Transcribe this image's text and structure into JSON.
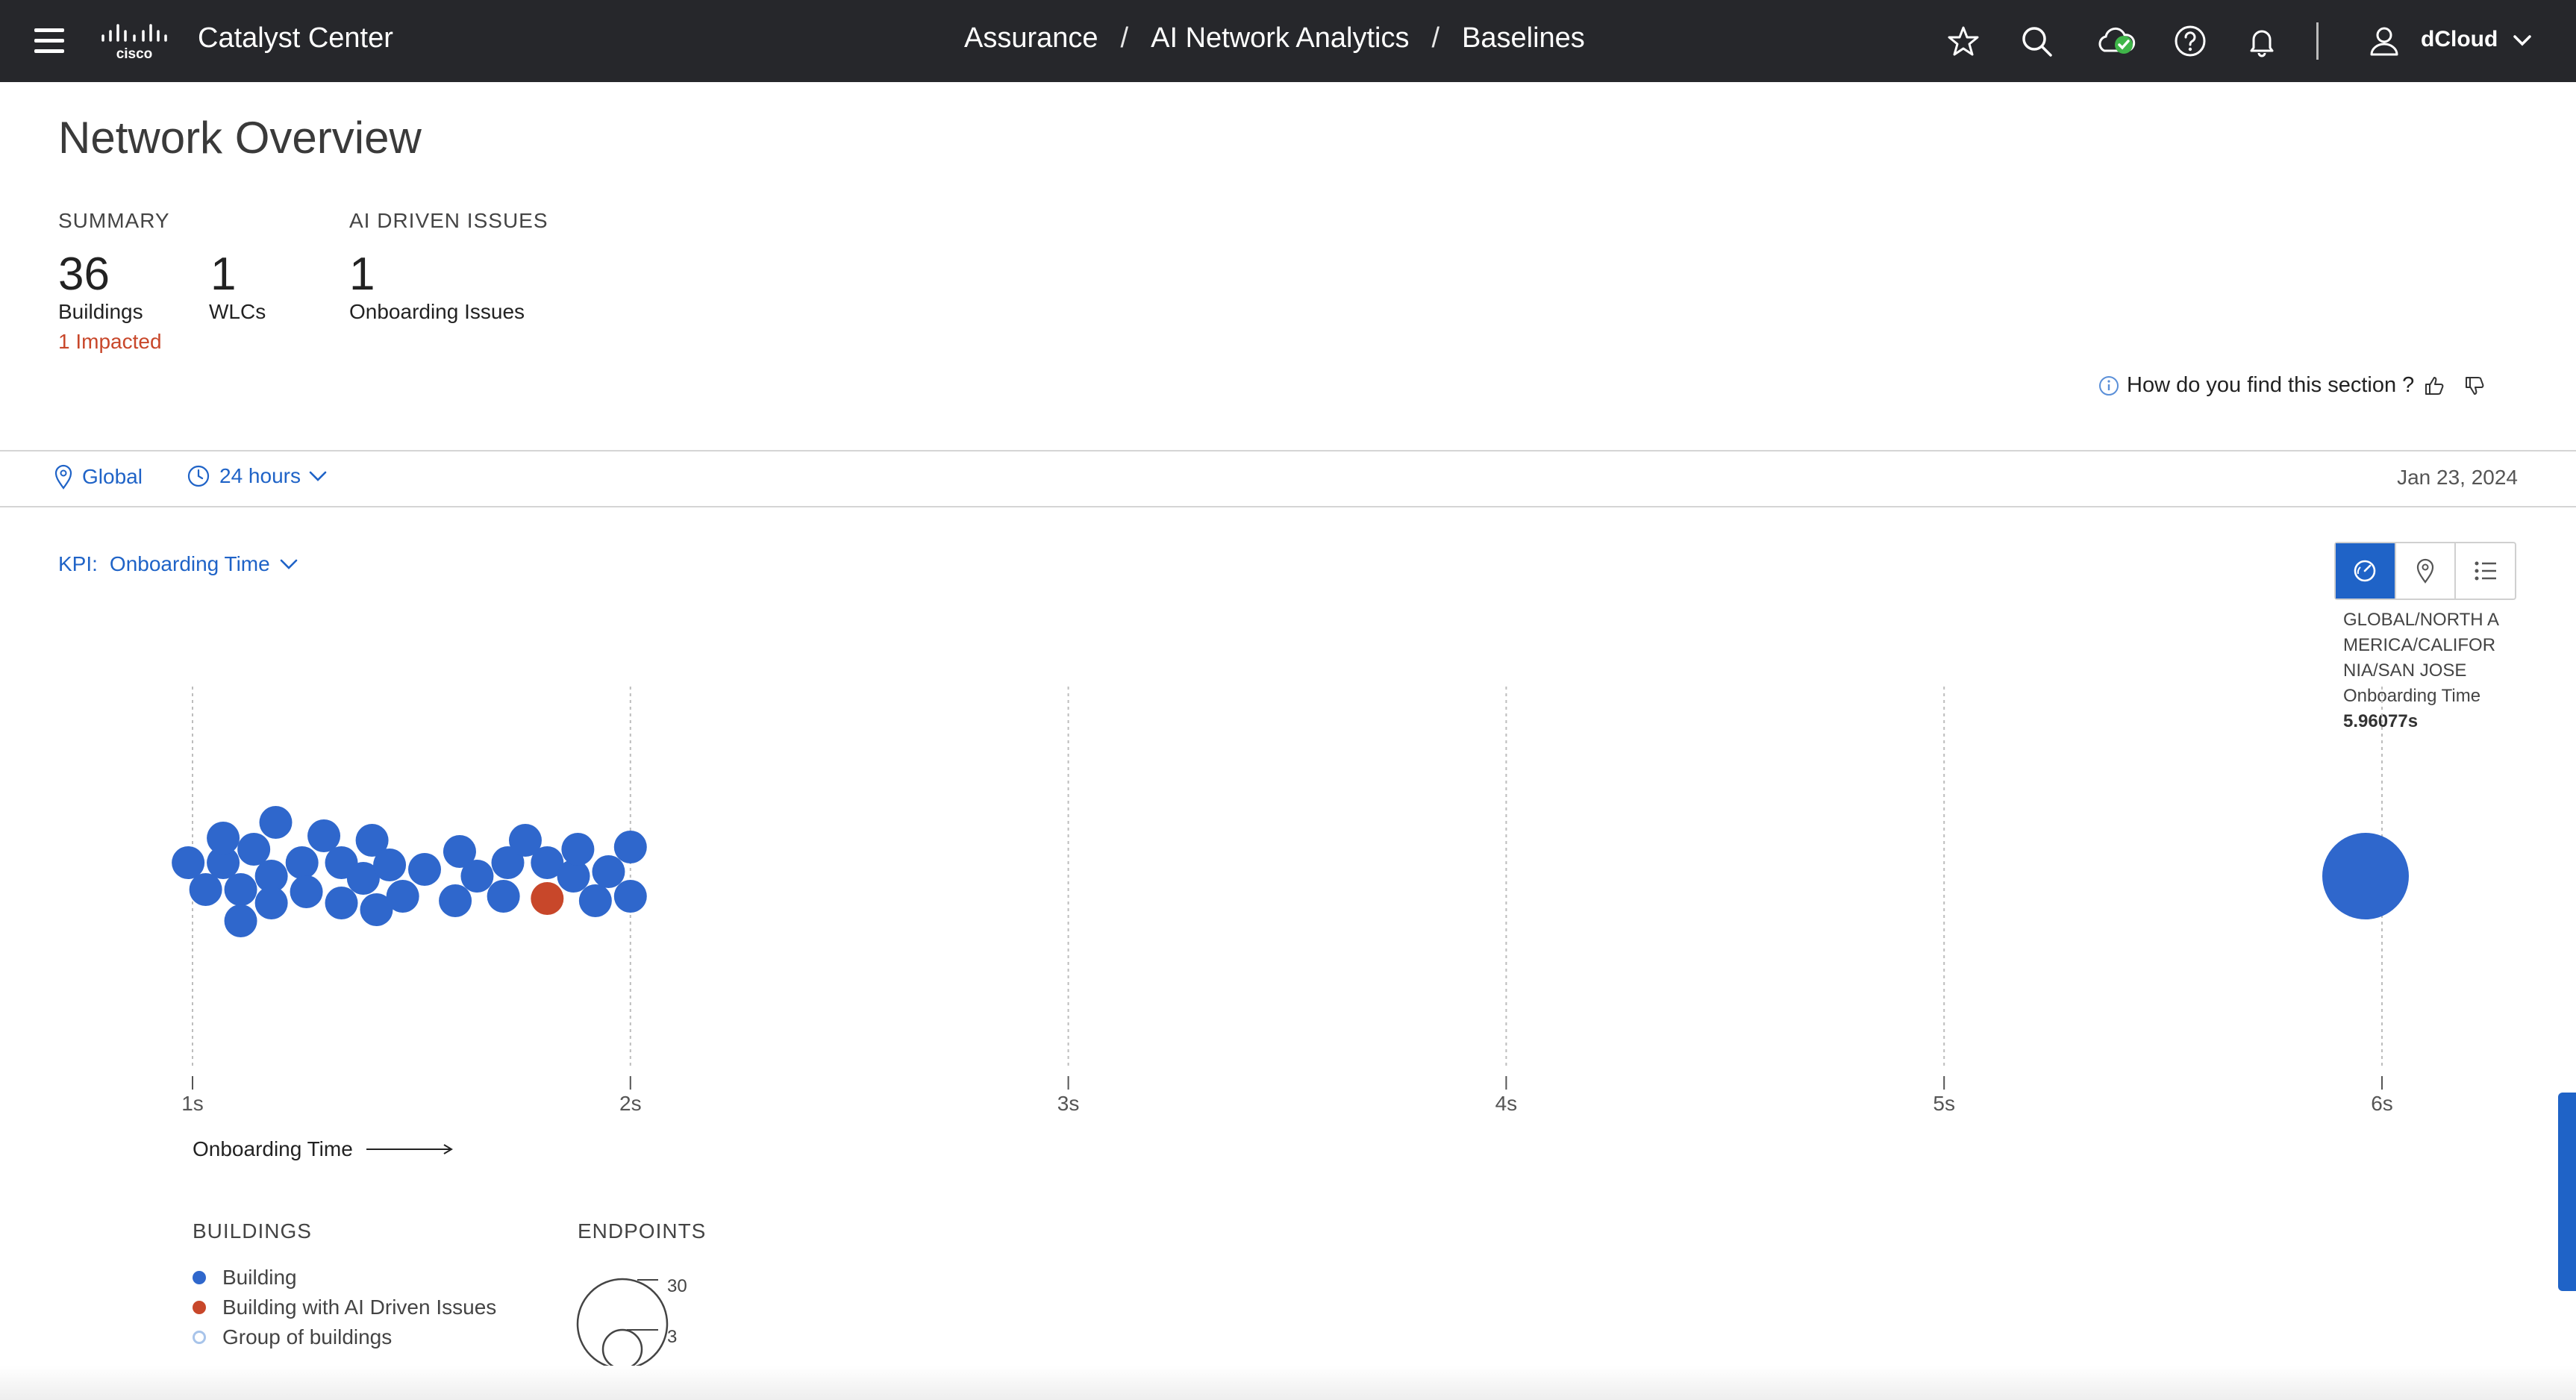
{
  "topbar": {
    "app_title": "Catalyst Center",
    "breadcrumbs": [
      "Assurance",
      "AI Network Analytics",
      "Baselines"
    ],
    "breadcrumb_sep": "/",
    "user": "dCloud",
    "health_status_color": "#3fb549",
    "icons": [
      "star-icon",
      "search-icon",
      "cloud-check-icon",
      "help-icon",
      "bell-icon",
      "user-icon",
      "chevron-down-icon"
    ]
  },
  "page": {
    "title": "Network Overview"
  },
  "summary": {
    "heading": "SUMMARY",
    "buildings_count": "36",
    "buildings_label": "Buildings",
    "buildings_impacted": "1 Impacted",
    "wlcs_count": "1",
    "wlcs_label": "WLCs"
  },
  "ai_issues": {
    "heading": "AI DRIVEN ISSUES",
    "count": "1",
    "label": "Onboarding Issues"
  },
  "feedback": {
    "question": "How do you find this section ?"
  },
  "filters": {
    "location": "Global",
    "time_range": "24 hours",
    "date": "Jan 23, 2024"
  },
  "kpi": {
    "label": "KPI:",
    "value": "Onboarding Time"
  },
  "view_toggle": [
    "chart-view",
    "map-view",
    "list-view"
  ],
  "tooltip": {
    "path": "GLOBAL/NORTH AMERICA/CALIFORNIA/SAN JOSE",
    "kpi": "Onboarding Time",
    "value": "5.96077s"
  },
  "chart_data": {
    "type": "scatter",
    "x_unit": "s",
    "xlim": [
      1,
      6
    ],
    "ticks": [
      1,
      2,
      3,
      4,
      5,
      6
    ],
    "tick_labels": [
      "1s",
      "2s",
      "3s",
      "4s",
      "5s",
      "6s"
    ],
    "xlabel": "Onboarding Time",
    "colors": {
      "building": "#2f67cc",
      "issue": "#c8472a"
    },
    "points": [
      {
        "x": 0.99,
        "y": 0.06,
        "kind": "building"
      },
      {
        "x": 1.03,
        "y": -0.06,
        "kind": "building"
      },
      {
        "x": 1.07,
        "y": 0.06,
        "kind": "building"
      },
      {
        "x": 1.07,
        "y": 0.17,
        "kind": "building"
      },
      {
        "x": 1.11,
        "y": -0.06,
        "kind": "building"
      },
      {
        "x": 1.11,
        "y": -0.2,
        "kind": "building"
      },
      {
        "x": 1.14,
        "y": 0.12,
        "kind": "building"
      },
      {
        "x": 1.18,
        "y": 0.0,
        "kind": "building"
      },
      {
        "x": 1.18,
        "y": -0.12,
        "kind": "building"
      },
      {
        "x": 1.19,
        "y": 0.24,
        "kind": "building"
      },
      {
        "x": 1.25,
        "y": 0.06,
        "kind": "building"
      },
      {
        "x": 1.26,
        "y": -0.07,
        "kind": "building"
      },
      {
        "x": 1.3,
        "y": 0.18,
        "kind": "building"
      },
      {
        "x": 1.34,
        "y": 0.06,
        "kind": "building"
      },
      {
        "x": 1.34,
        "y": -0.12,
        "kind": "building"
      },
      {
        "x": 1.39,
        "y": -0.01,
        "kind": "building"
      },
      {
        "x": 1.41,
        "y": 0.16,
        "kind": "building"
      },
      {
        "x": 1.42,
        "y": -0.15,
        "kind": "building"
      },
      {
        "x": 1.45,
        "y": 0.05,
        "kind": "building"
      },
      {
        "x": 1.48,
        "y": -0.09,
        "kind": "building"
      },
      {
        "x": 1.53,
        "y": 0.03,
        "kind": "building"
      },
      {
        "x": 1.6,
        "y": -0.11,
        "kind": "building"
      },
      {
        "x": 1.61,
        "y": 0.11,
        "kind": "building"
      },
      {
        "x": 1.65,
        "y": 0.0,
        "kind": "building"
      },
      {
        "x": 1.71,
        "y": -0.09,
        "kind": "building"
      },
      {
        "x": 1.72,
        "y": 0.06,
        "kind": "building"
      },
      {
        "x": 1.76,
        "y": 0.16,
        "kind": "building"
      },
      {
        "x": 1.81,
        "y": 0.06,
        "kind": "building"
      },
      {
        "x": 1.81,
        "y": -0.1,
        "kind": "issue"
      },
      {
        "x": 1.87,
        "y": 0.0,
        "kind": "building"
      },
      {
        "x": 1.88,
        "y": 0.12,
        "kind": "building"
      },
      {
        "x": 1.92,
        "y": -0.11,
        "kind": "building"
      },
      {
        "x": 1.95,
        "y": 0.02,
        "kind": "building"
      },
      {
        "x": 2.0,
        "y": 0.13,
        "kind": "building"
      },
      {
        "x": 2.0,
        "y": -0.09,
        "kind": "building"
      },
      {
        "x": 5.96077,
        "y": 0.0,
        "kind": "selected"
      }
    ]
  },
  "legend": {
    "buildings_heading": "BUILDINGS",
    "items": [
      {
        "label": "Building",
        "color": "#2f67cc"
      },
      {
        "label": "Building with AI Driven Issues",
        "color": "#c8472a"
      },
      {
        "label": "Group of buildings",
        "color": "#a8c4ea"
      }
    ],
    "endpoints_heading": "ENDPOINTS",
    "endpoints_max": "30",
    "endpoints_min": "3"
  }
}
